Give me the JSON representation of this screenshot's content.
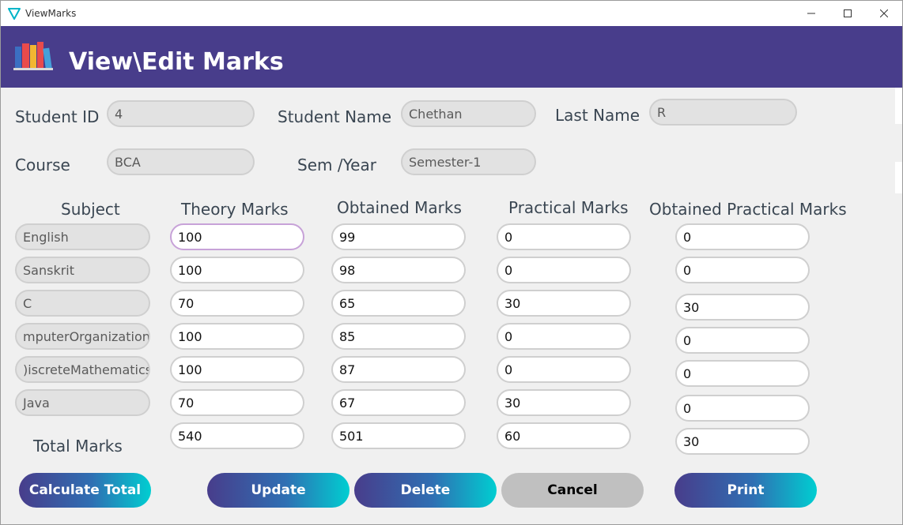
{
  "window": {
    "title": "ViewMarks"
  },
  "header": {
    "title": "View\\Edit Marks"
  },
  "student": {
    "id_label": "Student ID",
    "id_value": "4",
    "name_label": "Student Name",
    "name_value": "Chethan",
    "last_label": "Last Name",
    "last_value": "R",
    "course_label": "Course",
    "course_value": "BCA",
    "sem_label": "Sem /Year",
    "sem_value": "Semester-1"
  },
  "columns": {
    "subject": "Subject",
    "theory": "Theory Marks",
    "obtained": "Obtained Marks",
    "practical": "Practical Marks",
    "obtained_practical": "Obtained Practical Marks"
  },
  "rows": [
    {
      "subject": "English",
      "theory": "100",
      "obtained": "99",
      "practical": "0",
      "obtained_practical": "0"
    },
    {
      "subject": "Sanskrit",
      "theory": "100",
      "obtained": "98",
      "practical": "0",
      "obtained_practical": "0"
    },
    {
      "subject": "C",
      "theory": "70",
      "obtained": "65",
      "practical": "30",
      "obtained_practical": "30"
    },
    {
      "subject": "mputerOrganization",
      "theory": "100",
      "obtained": "85",
      "practical": "0",
      "obtained_practical": "0"
    },
    {
      "subject": ")iscreteMathematics",
      "theory": "100",
      "obtained": "87",
      "practical": "0",
      "obtained_practical": "0"
    },
    {
      "subject": "Java",
      "theory": "70",
      "obtained": "67",
      "practical": "30",
      "obtained_practical": "0"
    }
  ],
  "totals": {
    "label": "Total Marks",
    "theory": "540",
    "obtained": "501",
    "practical": "60",
    "obtained_practical": "30"
  },
  "buttons": {
    "calculate": "Calculate Total",
    "update": "Update",
    "delete": "Delete",
    "cancel": "Cancel",
    "print": "Print"
  },
  "colors": {
    "header": "#483d8b",
    "accent_start": "#483d8b",
    "accent_end": "#00ced1",
    "cancel": "#c0c0c0"
  },
  "icons": {
    "app": "view-triangle-icon",
    "logo": "books-icon"
  }
}
